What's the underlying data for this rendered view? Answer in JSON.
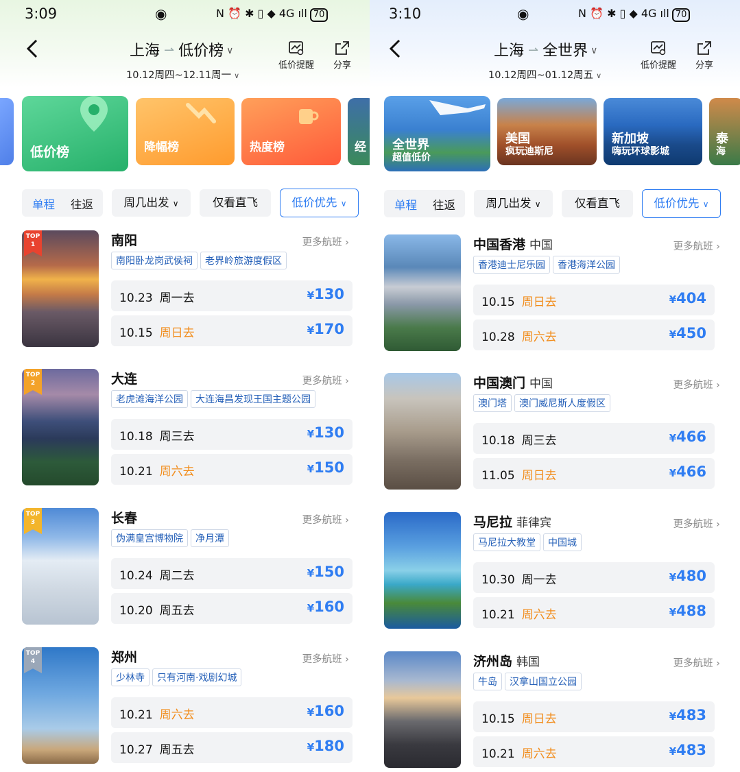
{
  "left": {
    "status": {
      "time": "3:09",
      "icons": "N ⏰ ✱ ▯ ◆ 4G ıll",
      "battery": "70"
    },
    "route": {
      "from": "上海",
      "to": "低价榜",
      "dates": "10.12周四~12.11周一"
    },
    "header_buttons": {
      "alert": "低价提醒",
      "share": "分享"
    },
    "categories": [
      {
        "label": "低价榜"
      },
      {
        "label": "降幅榜"
      },
      {
        "label": "热度榜"
      },
      {
        "label": "经"
      }
    ],
    "filters": {
      "one_way": "单程",
      "round_trip": "往返",
      "weekday": "周几出发",
      "direct": "仅看直飞",
      "sort": "低价优先"
    },
    "destinations": [
      {
        "rank": "1",
        "city": "南阳",
        "country": "",
        "more": "更多航班",
        "tags": [
          "南阳卧龙岗武侯祠",
          "老界岭旅游度假区"
        ],
        "flights": [
          {
            "date": "10.23",
            "weekday": "周一去",
            "weekend": false,
            "price": "130"
          },
          {
            "date": "10.15",
            "weekday": "周日去",
            "weekend": true,
            "price": "170"
          }
        ]
      },
      {
        "rank": "2",
        "city": "大连",
        "country": "",
        "more": "更多航班",
        "tags": [
          "老虎滩海洋公园",
          "大连海昌发现王国主题公园"
        ],
        "flights": [
          {
            "date": "10.18",
            "weekday": "周三去",
            "weekend": false,
            "price": "130"
          },
          {
            "date": "10.21",
            "weekday": "周六去",
            "weekend": true,
            "price": "150"
          }
        ]
      },
      {
        "rank": "3",
        "city": "长春",
        "country": "",
        "more": "更多航班",
        "tags": [
          "伪满皇宫博物院",
          "净月潭"
        ],
        "flights": [
          {
            "date": "10.24",
            "weekday": "周二去",
            "weekend": false,
            "price": "150"
          },
          {
            "date": "10.20",
            "weekday": "周五去",
            "weekend": false,
            "price": "160"
          }
        ]
      },
      {
        "rank": "4",
        "city": "郑州",
        "country": "",
        "more": "更多航班",
        "tags": [
          "少林寺",
          "只有河南·戏剧幻城"
        ],
        "flights": [
          {
            "date": "10.21",
            "weekday": "周六去",
            "weekend": true,
            "price": "160"
          },
          {
            "date": "10.27",
            "weekday": "周五去",
            "weekend": false,
            "price": "180"
          }
        ]
      }
    ]
  },
  "right": {
    "status": {
      "time": "3:10",
      "icons": "N ⏰ ✱ ▯ ◆ 4G ıll",
      "battery": "70"
    },
    "route": {
      "from": "上海",
      "to": "全世界",
      "dates": "10.12周四~01.12周五"
    },
    "header_buttons": {
      "alert": "低价提醒",
      "share": "分享"
    },
    "categories": [
      {
        "title": "全世界",
        "sub": "超值低价"
      },
      {
        "title": "美国",
        "sub": "疯玩迪斯尼"
      },
      {
        "title": "新加坡",
        "sub": "嗨玩环球影城"
      },
      {
        "title": "泰",
        "sub": "海"
      }
    ],
    "filters": {
      "one_way": "单程",
      "round_trip": "往返",
      "weekday": "周几出发",
      "direct": "仅看直飞",
      "sort": "低价优先"
    },
    "destinations": [
      {
        "city": "中国香港",
        "country": "中国",
        "more": "更多航班",
        "tags": [
          "香港迪士尼乐园",
          "香港海洋公园"
        ],
        "flights": [
          {
            "date": "10.15",
            "weekday": "周日去",
            "weekend": true,
            "price": "404"
          },
          {
            "date": "10.28",
            "weekday": "周六去",
            "weekend": true,
            "price": "450"
          }
        ]
      },
      {
        "city": "中国澳门",
        "country": "中国",
        "more": "更多航班",
        "tags": [
          "澳门塔",
          "澳门威尼斯人度假区"
        ],
        "flights": [
          {
            "date": "10.18",
            "weekday": "周三去",
            "weekend": false,
            "price": "466"
          },
          {
            "date": "11.05",
            "weekday": "周日去",
            "weekend": true,
            "price": "466"
          }
        ]
      },
      {
        "city": "马尼拉",
        "country": "菲律宾",
        "more": "更多航班",
        "tags": [
          "马尼拉大教堂",
          "中国城"
        ],
        "flights": [
          {
            "date": "10.30",
            "weekday": "周一去",
            "weekend": false,
            "price": "480"
          },
          {
            "date": "10.21",
            "weekday": "周六去",
            "weekend": true,
            "price": "488"
          }
        ]
      },
      {
        "city": "济州岛",
        "country": "韩国",
        "more": "更多航班",
        "tags": [
          "牛岛",
          "汉拿山国立公园"
        ],
        "flights": [
          {
            "date": "10.15",
            "weekday": "周日去",
            "weekend": true,
            "price": "483"
          },
          {
            "date": "10.21",
            "weekday": "周六去",
            "weekend": true,
            "price": "483"
          }
        ]
      }
    ]
  },
  "common": {
    "top_label": "TOP",
    "currency": "¥"
  },
  "colors": {
    "accent": "#2f7df2",
    "weekend": "#f28c1a",
    "green": "#3cc07a",
    "orange": "#ffa437"
  }
}
